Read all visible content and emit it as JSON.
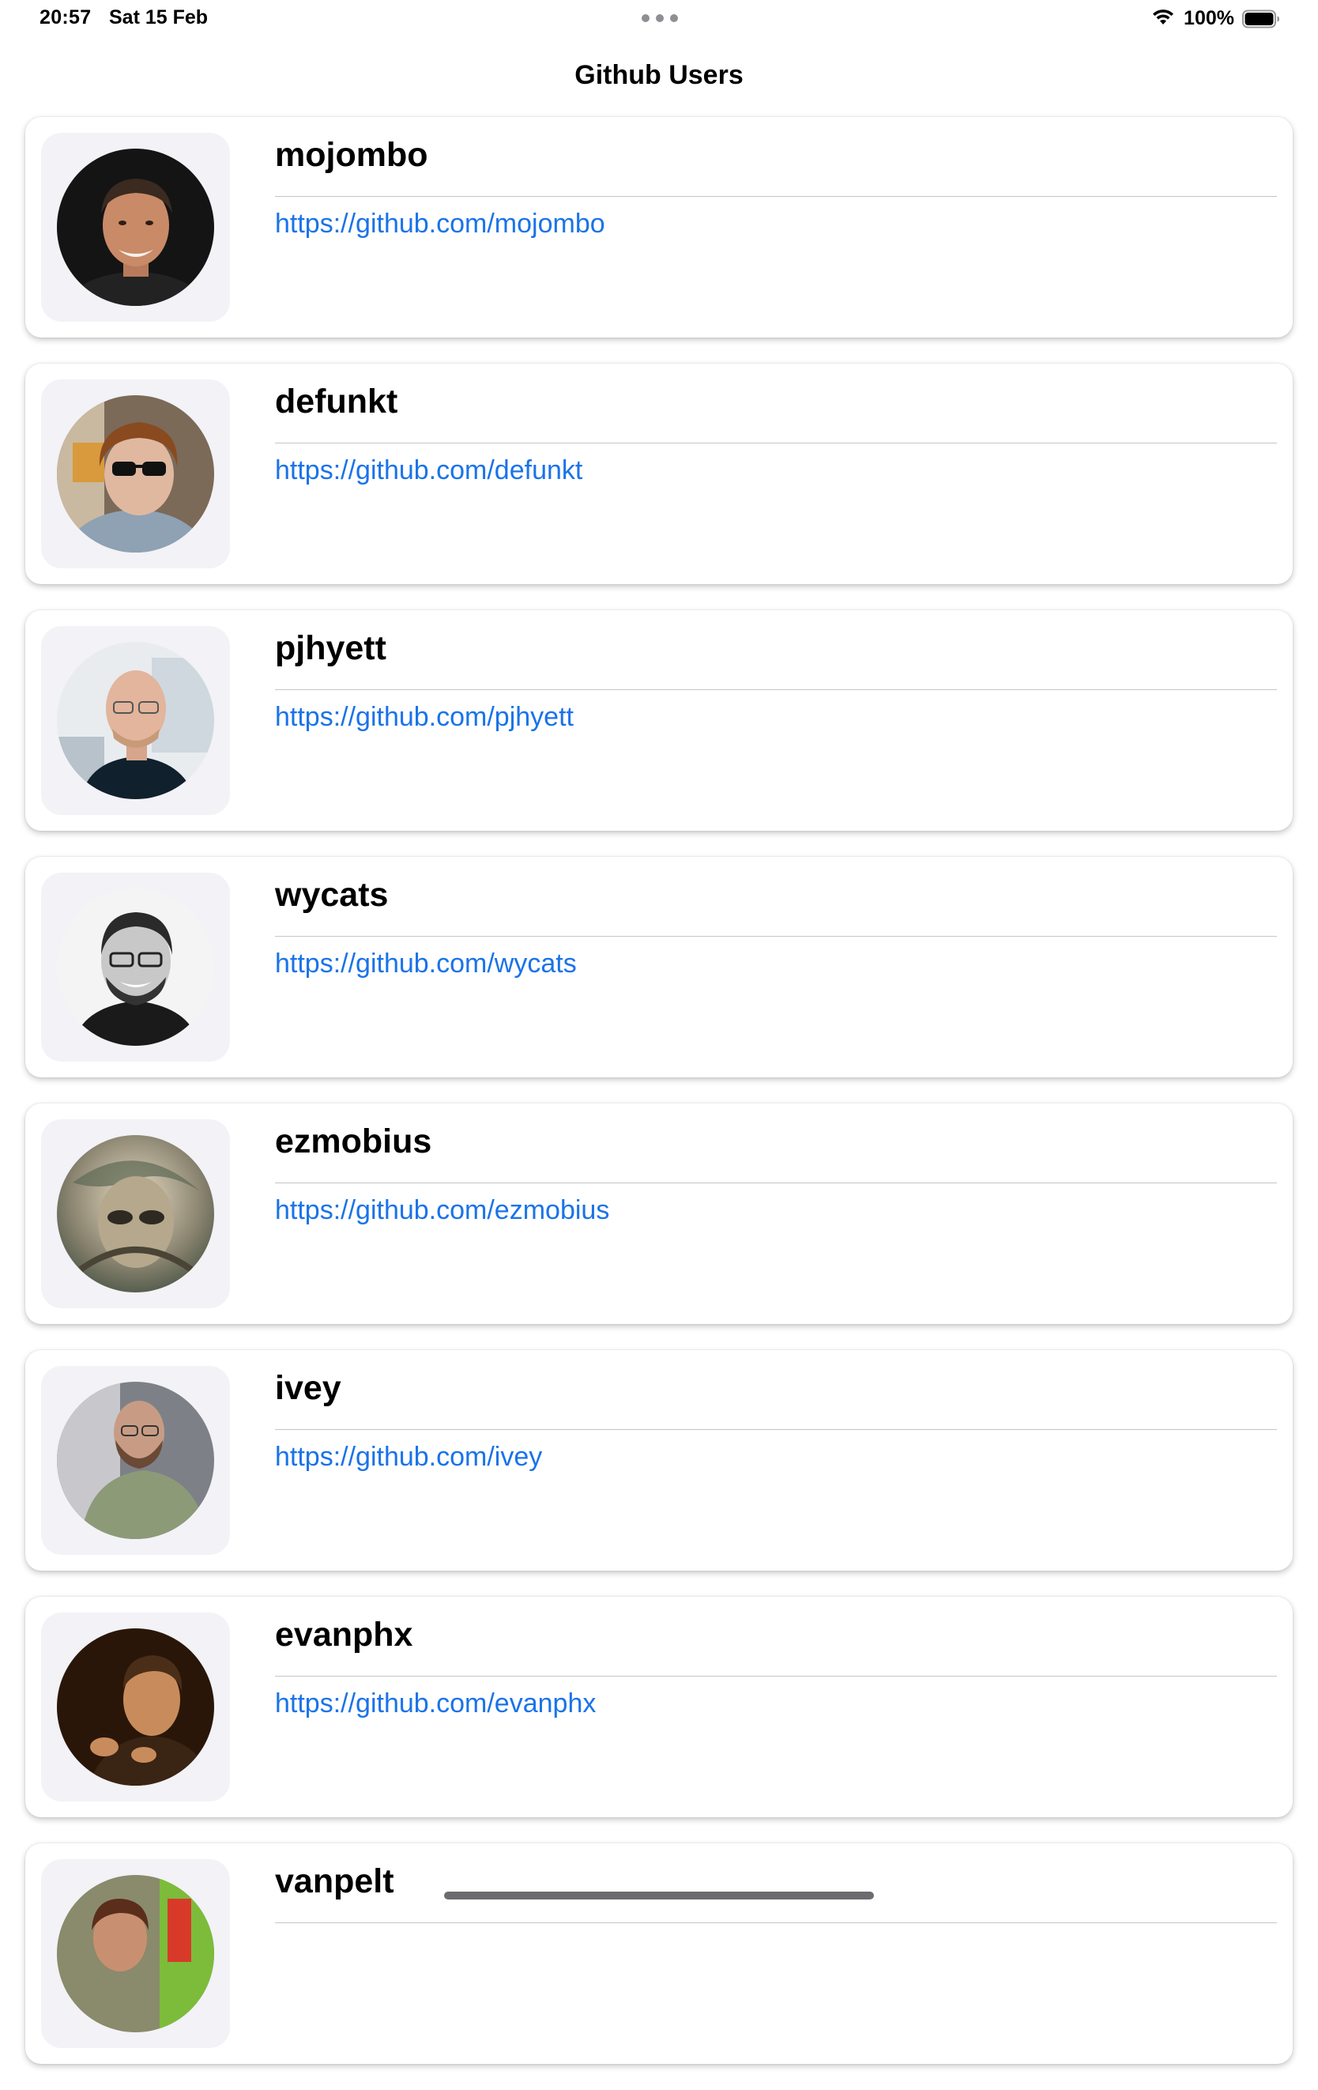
{
  "status_bar": {
    "time": "20:57",
    "date": "Sat 15 Feb",
    "battery_percent": "100%",
    "battery_level": 1.0,
    "icons": [
      "wifi-icon",
      "battery-icon",
      "multitasking-dots-icon"
    ]
  },
  "navigation": {
    "title": "Github Users"
  },
  "users": [
    {
      "login": "mojombo",
      "url": "https://github.com/mojombo"
    },
    {
      "login": "defunkt",
      "url": "https://github.com/defunkt"
    },
    {
      "login": "pjhyett",
      "url": "https://github.com/pjhyett"
    },
    {
      "login": "wycats",
      "url": "https://github.com/wycats"
    },
    {
      "login": "ezmobius",
      "url": "https://github.com/ezmobius"
    },
    {
      "login": "ivey",
      "url": "https://github.com/ivey"
    },
    {
      "login": "evanphx",
      "url": "https://github.com/evanphx"
    },
    {
      "login": "vanpelt",
      "url": ""
    }
  ],
  "colors": {
    "link": "#1a73e8",
    "avatar_background": "#f2f2f7",
    "card_background": "#ffffff"
  }
}
